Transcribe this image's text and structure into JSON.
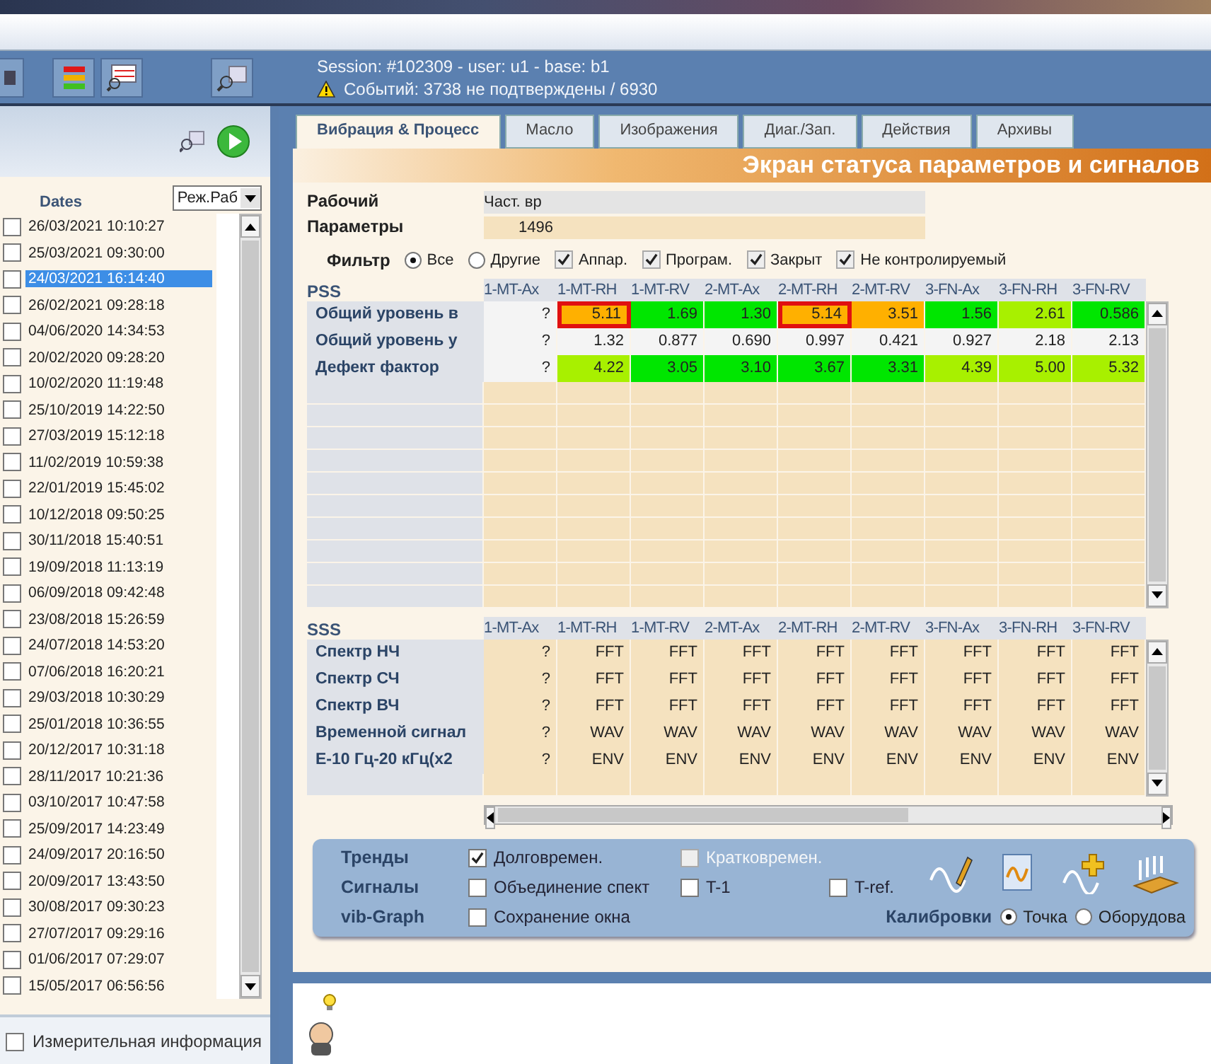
{
  "session": {
    "line": "Session: #102309 - user: u1 - base: b1",
    "events": "Событий: 3738 не подтверждены / 6930"
  },
  "dates_panel": {
    "heading": "Dates",
    "mode": "Реж.Раб",
    "dates": [
      {
        "text": "26/03/2021 10:10:27",
        "selected": false,
        "checked": false
      },
      {
        "text": "25/03/2021 09:30:00",
        "selected": false,
        "checked": false
      },
      {
        "text": "24/03/2021 16:14:40",
        "selected": true,
        "checked": false
      },
      {
        "text": "26/02/2021 09:28:18",
        "selected": false,
        "checked": false
      },
      {
        "text": "04/06/2020 14:34:53",
        "selected": false,
        "checked": false
      },
      {
        "text": "20/02/2020 09:28:20",
        "selected": false,
        "checked": false
      },
      {
        "text": "10/02/2020 11:19:48",
        "selected": false,
        "checked": false
      },
      {
        "text": "25/10/2019 14:22:50",
        "selected": false,
        "checked": false
      },
      {
        "text": "27/03/2019 15:12:18",
        "selected": false,
        "checked": false
      },
      {
        "text": "11/02/2019 10:59:38",
        "selected": false,
        "checked": false
      },
      {
        "text": "22/01/2019 15:45:02",
        "selected": false,
        "checked": false
      },
      {
        "text": "10/12/2018 09:50:25",
        "selected": false,
        "checked": false
      },
      {
        "text": "30/11/2018 15:40:51",
        "selected": false,
        "checked": false
      },
      {
        "text": "19/09/2018 11:13:19",
        "selected": false,
        "checked": false
      },
      {
        "text": "06/09/2018 09:42:48",
        "selected": false,
        "checked": false
      },
      {
        "text": "23/08/2018 15:26:59",
        "selected": false,
        "checked": false
      },
      {
        "text": "24/07/2018 14:53:20",
        "selected": false,
        "checked": false
      },
      {
        "text": "07/06/2018 16:20:21",
        "selected": false,
        "checked": false
      },
      {
        "text": "29/03/2018 10:30:29",
        "selected": false,
        "checked": false
      },
      {
        "text": "25/01/2018 10:36:55",
        "selected": false,
        "checked": false
      },
      {
        "text": "20/12/2017 10:31:18",
        "selected": false,
        "checked": false
      },
      {
        "text": "28/11/2017 10:21:36",
        "selected": false,
        "checked": false
      },
      {
        "text": "03/10/2017 10:47:58",
        "selected": false,
        "checked": false
      },
      {
        "text": "25/09/2017 14:23:49",
        "selected": false,
        "checked": false
      },
      {
        "text": "24/09/2017 20:16:50",
        "selected": false,
        "checked": false
      },
      {
        "text": "20/09/2017 13:43:50",
        "selected": false,
        "checked": false
      },
      {
        "text": "30/08/2017 09:30:23",
        "selected": false,
        "checked": false
      },
      {
        "text": "27/07/2017 09:29:16",
        "selected": false,
        "checked": false
      },
      {
        "text": "01/06/2017 07:29:07",
        "selected": false,
        "checked": false
      },
      {
        "text": "15/05/2017 06:56:56",
        "selected": false,
        "checked": false
      }
    ],
    "measurement": {
      "label": "Измерительная информация",
      "checked": false
    }
  },
  "tabs": [
    {
      "label": "Вибрация & Процесс",
      "selected": true
    },
    {
      "label": "Масло",
      "selected": false
    },
    {
      "label": "Изображения",
      "selected": false
    },
    {
      "label": "Диаг./Зап.",
      "selected": false
    },
    {
      "label": "Действия",
      "selected": false
    },
    {
      "label": "Архивы",
      "selected": false
    }
  ],
  "banner": "Экран статуса параметров и сигналов",
  "params": {
    "labels": [
      "Рабочий",
      "Параметры"
    ],
    "values": [
      "Част. вр",
      "1496"
    ]
  },
  "filter": {
    "label": "Фильтр",
    "options": [
      {
        "kind": "radio",
        "label": "Все",
        "selected": true
      },
      {
        "kind": "radio",
        "label": "Другие",
        "selected": false
      },
      {
        "kind": "checkbox",
        "label": "Аппар.",
        "checked": true
      },
      {
        "kind": "checkbox",
        "label": "Програм.",
        "checked": true
      },
      {
        "kind": "checkbox",
        "label": "Закрыт",
        "checked": true
      },
      {
        "kind": "checkbox",
        "label": "Не контролируемый",
        "checked": true
      }
    ]
  },
  "pss": {
    "title": "PSS",
    "columns": [
      "1-MT-Ax",
      "1-MT-RH",
      "1-MT-RV",
      "2-MT-Ax",
      "2-MT-RH",
      "2-MT-RV",
      "3-FN-Ax",
      "3-FN-RH",
      "3-FN-RV"
    ],
    "rows": [
      {
        "label": "Общий уровень в",
        "cells": [
          {
            "text": "?"
          },
          {
            "text": "5.11",
            "color": "#ffb000",
            "flagged": true
          },
          {
            "text": "1.69",
            "color": "#00e600"
          },
          {
            "text": "1.30",
            "color": "#00e600"
          },
          {
            "text": "5.14",
            "color": "#ffb000",
            "flagged": true
          },
          {
            "text": "3.51",
            "color": "#ffb000"
          },
          {
            "text": "1.56",
            "color": "#00e600"
          },
          {
            "text": "2.61",
            "color": "#a8f000"
          },
          {
            "text": "0.586",
            "color": "#00e600"
          }
        ]
      },
      {
        "label": "Общий уровень у",
        "cells": [
          {
            "text": "?"
          },
          {
            "text": "1.32"
          },
          {
            "text": "0.877"
          },
          {
            "text": "0.690"
          },
          {
            "text": "0.997"
          },
          {
            "text": "0.421"
          },
          {
            "text": "0.927"
          },
          {
            "text": "2.18"
          },
          {
            "text": "2.13"
          }
        ]
      },
      {
        "label": "Дефект фактор",
        "cells": [
          {
            "text": "?"
          },
          {
            "text": "4.22",
            "color": "#a8f000"
          },
          {
            "text": "3.05",
            "color": "#00e600"
          },
          {
            "text": "3.10",
            "color": "#00e600"
          },
          {
            "text": "3.67",
            "color": "#00e600"
          },
          {
            "text": "3.31",
            "color": "#00e600"
          },
          {
            "text": "4.39",
            "color": "#a8f000"
          },
          {
            "text": "5.00",
            "color": "#a8f000"
          },
          {
            "text": "5.32",
            "color": "#a8f000"
          }
        ]
      }
    ]
  },
  "sss": {
    "title": "SSS",
    "columns": [
      "1-MT-Ax",
      "1-MT-RH",
      "1-MT-RV",
      "2-MT-Ax",
      "2-MT-RH",
      "2-MT-RV",
      "3-FN-Ax",
      "3-FN-RH",
      "3-FN-RV"
    ],
    "rows": [
      {
        "label": "Спектр НЧ",
        "cells": [
          "?",
          "FFT",
          "FFT",
          "FFT",
          "FFT",
          "FFT",
          "FFT",
          "FFT",
          "FFT"
        ]
      },
      {
        "label": "Спектр СЧ",
        "cells": [
          "?",
          "FFT",
          "FFT",
          "FFT",
          "FFT",
          "FFT",
          "FFT",
          "FFT",
          "FFT"
        ]
      },
      {
        "label": "Спектр ВЧ",
        "cells": [
          "?",
          "FFT",
          "FFT",
          "FFT",
          "FFT",
          "FFT",
          "FFT",
          "FFT",
          "FFT"
        ]
      },
      {
        "label": "Временной сигнал",
        "cells": [
          "?",
          "WAV",
          "WAV",
          "WAV",
          "WAV",
          "WAV",
          "WAV",
          "WAV",
          "WAV"
        ]
      },
      {
        "label": "Е-10 Гц-20 кГц(х2",
        "cells": [
          "?",
          "ENV",
          "ENV",
          "ENV",
          "ENV",
          "ENV",
          "ENV",
          "ENV",
          "ENV"
        ]
      }
    ]
  },
  "options_panel": {
    "rows": [
      {
        "label": "Тренды",
        "options": [
          {
            "label": "Долговремен.",
            "checked": true,
            "disabled": false
          },
          {
            "label": "Кратковремен.",
            "checked": false,
            "disabled": true
          }
        ]
      },
      {
        "label": "Сигналы",
        "options": [
          {
            "label": "Объединение спект",
            "checked": false,
            "disabled": false
          },
          {
            "label": "T-1",
            "checked": false,
            "disabled": false
          },
          {
            "label": "T-ref.",
            "checked": false,
            "disabled": false
          }
        ]
      },
      {
        "label": "vib-Graph",
        "options": [
          {
            "label": "Сохранение окна",
            "checked": false,
            "disabled": false
          }
        ]
      }
    ],
    "calibration": {
      "label": "Калибровки",
      "options": [
        {
          "label": "Точка",
          "selected": true
        },
        {
          "label": "Оборудова",
          "selected": false
        }
      ]
    }
  }
}
